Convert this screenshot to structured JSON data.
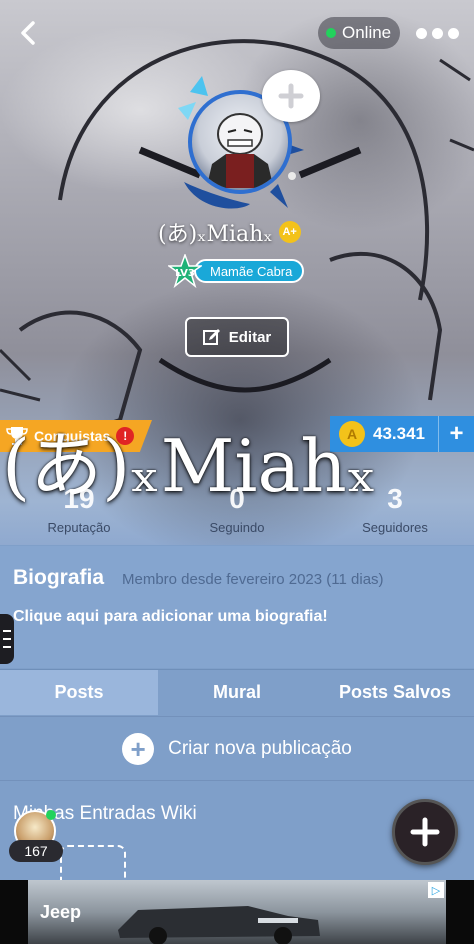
{
  "header": {
    "status": "Online",
    "nickname": "(あ)ₓMiahₓ",
    "level": "LV3",
    "level_title": "Mamãe Cabra",
    "edit_label": "Editar"
  },
  "achievements": {
    "label": "Conquistas",
    "alert": "!"
  },
  "coins": {
    "value": "43.341",
    "plus": "+"
  },
  "banner_nickname": "(あ)ₓMiahₓ",
  "stats": [
    {
      "value": "19",
      "label": "Reputação"
    },
    {
      "value": "0",
      "label": "Seguindo"
    },
    {
      "value": "3",
      "label": "Seguidores"
    }
  ],
  "bio": {
    "title": "Biografia",
    "member_since": "Membro desde fevereiro 2023 (11 dias)",
    "add_prompt": "Clique aqui para adicionar uma biografia!"
  },
  "tabs": [
    {
      "label": "Posts",
      "active": true
    },
    {
      "label": "Mural",
      "active": false
    },
    {
      "label": "Posts Salvos",
      "active": false
    }
  ],
  "create_post": {
    "label": "Criar nova publicação"
  },
  "wiki": {
    "title": "Minhas Entradas Wiki"
  },
  "mini_profile": {
    "count": "167"
  },
  "ad": {
    "brand": "Jeep",
    "info": "▷"
  },
  "colors": {
    "accent_blue": "#2f8fe0",
    "page_blue": "#7f9fc9",
    "gold": "#f3c21a",
    "achievement_orange": "#f5a623",
    "online_green": "#22d25c"
  }
}
